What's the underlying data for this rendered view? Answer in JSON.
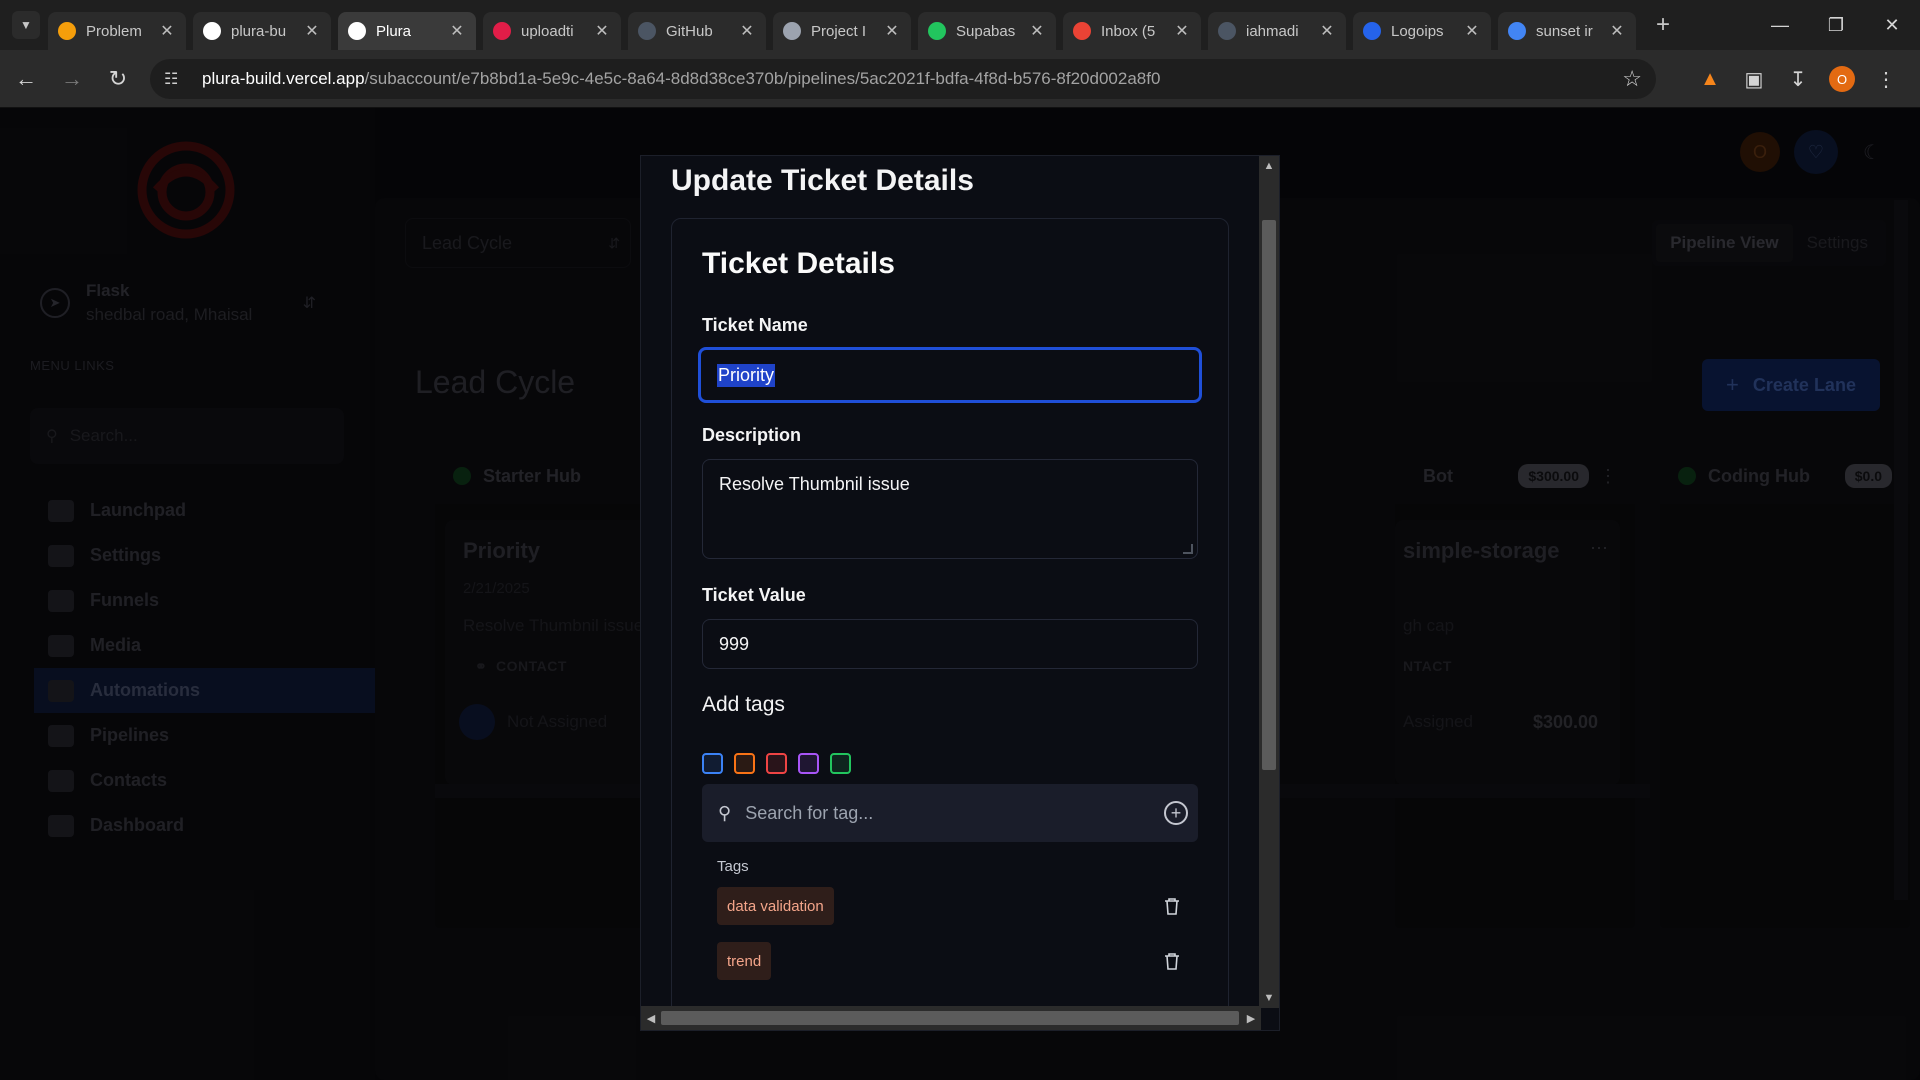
{
  "browser": {
    "tabs": [
      {
        "title": "Problem",
        "favicon": "problem-icon",
        "color": "#f59e0b",
        "active": false
      },
      {
        "title": "plura-bu",
        "favicon": "vercel-icon",
        "color": "#ffffff",
        "active": false
      },
      {
        "title": "Plura",
        "favicon": "vercel-icon",
        "color": "#ffffff",
        "active": true
      },
      {
        "title": "uploadti",
        "favicon": "uploadthing-icon",
        "color": "#e11d48",
        "active": false
      },
      {
        "title": "GitHub",
        "favicon": "github-icon",
        "color": "#4b5563",
        "active": false
      },
      {
        "title": "Project I",
        "favicon": "openai-icon",
        "color": "#9ca3af",
        "active": false
      },
      {
        "title": "Supabas",
        "favicon": "supabase-icon",
        "color": "#22c55e",
        "active": false
      },
      {
        "title": "Inbox (5",
        "favicon": "gmail-icon",
        "color": "#ea4335",
        "active": false
      },
      {
        "title": "iahmadi",
        "favicon": "github-icon",
        "color": "#4b5563",
        "active": false
      },
      {
        "title": "Logoips",
        "favicon": "logoipsum-icon",
        "color": "#2563eb",
        "active": false
      },
      {
        "title": "sunset ir",
        "favicon": "google-icon",
        "color": "#4285f4",
        "active": false
      }
    ],
    "url_host": "plura-build.vercel.app",
    "url_path": "/subaccount/e7b8bd1a-5e9c-4e5c-8a64-8d8d38ce370b/pipelines/5ac2021f-bdfa-4f8d-b576-8f20d002a8f0",
    "profile_initial": "O"
  },
  "sidebar": {
    "account_name": "Flask",
    "account_address": "shedbal road, Mhaisal",
    "menu_title": "MENU LINKS",
    "search_placeholder": "Search...",
    "items": [
      {
        "label": "Launchpad",
        "icon": "clipboard-icon"
      },
      {
        "label": "Settings",
        "icon": "gear-icon"
      },
      {
        "label": "Funnels",
        "icon": "shuffle-icon"
      },
      {
        "label": "Media",
        "icon": "database-icon"
      },
      {
        "label": "Automations",
        "icon": "chip-icon",
        "active": true
      },
      {
        "label": "Pipelines",
        "icon": "flag-icon"
      },
      {
        "label": "Contacts",
        "icon": "person-icon"
      },
      {
        "label": "Dashboard",
        "icon": "grid-icon"
      }
    ]
  },
  "header": {
    "avatar_initial": "O"
  },
  "pipeline": {
    "selector": "Lead Cycle",
    "view_tabs": [
      "Pipeline View",
      "Settings"
    ],
    "title": "Lead Cycle",
    "create_lane": "Create Lane",
    "lanes": [
      {
        "name": "Starter Hub",
        "dot": "#16a34a",
        "amount": ""
      },
      {
        "name": "Bot",
        "dot": "",
        "amount": "$300.00"
      },
      {
        "name": "Coding Hub",
        "dot": "#16a34a",
        "amount": "$0.0"
      }
    ],
    "card_left": {
      "title": "Priority",
      "date": "2/21/2025",
      "desc": "Resolve Thumbnil issue",
      "contact": "CONTACT",
      "assignee": "Not Assigned"
    },
    "card_right": {
      "title": "simple-storage",
      "desc": "gh cap",
      "contact": "NTACT",
      "assignee": "Assigned",
      "amount": "$300.00"
    }
  },
  "modal": {
    "title": "Update Ticket Details",
    "card_title": "Ticket Details",
    "name_label": "Ticket Name",
    "name_value": "Priority",
    "desc_label": "Description",
    "desc_value": "Resolve Thumbnil issue",
    "value_label": "Ticket Value",
    "value_value": "999",
    "tags_heading": "Add tags",
    "swatch_colors": [
      "#3b82f6",
      "#f97316",
      "#ef4444",
      "#a855f7",
      "#22c55e"
    ],
    "tag_search_placeholder": "Search for tag...",
    "tags_sub": "Tags",
    "tags": [
      "data validation",
      "trend"
    ]
  }
}
